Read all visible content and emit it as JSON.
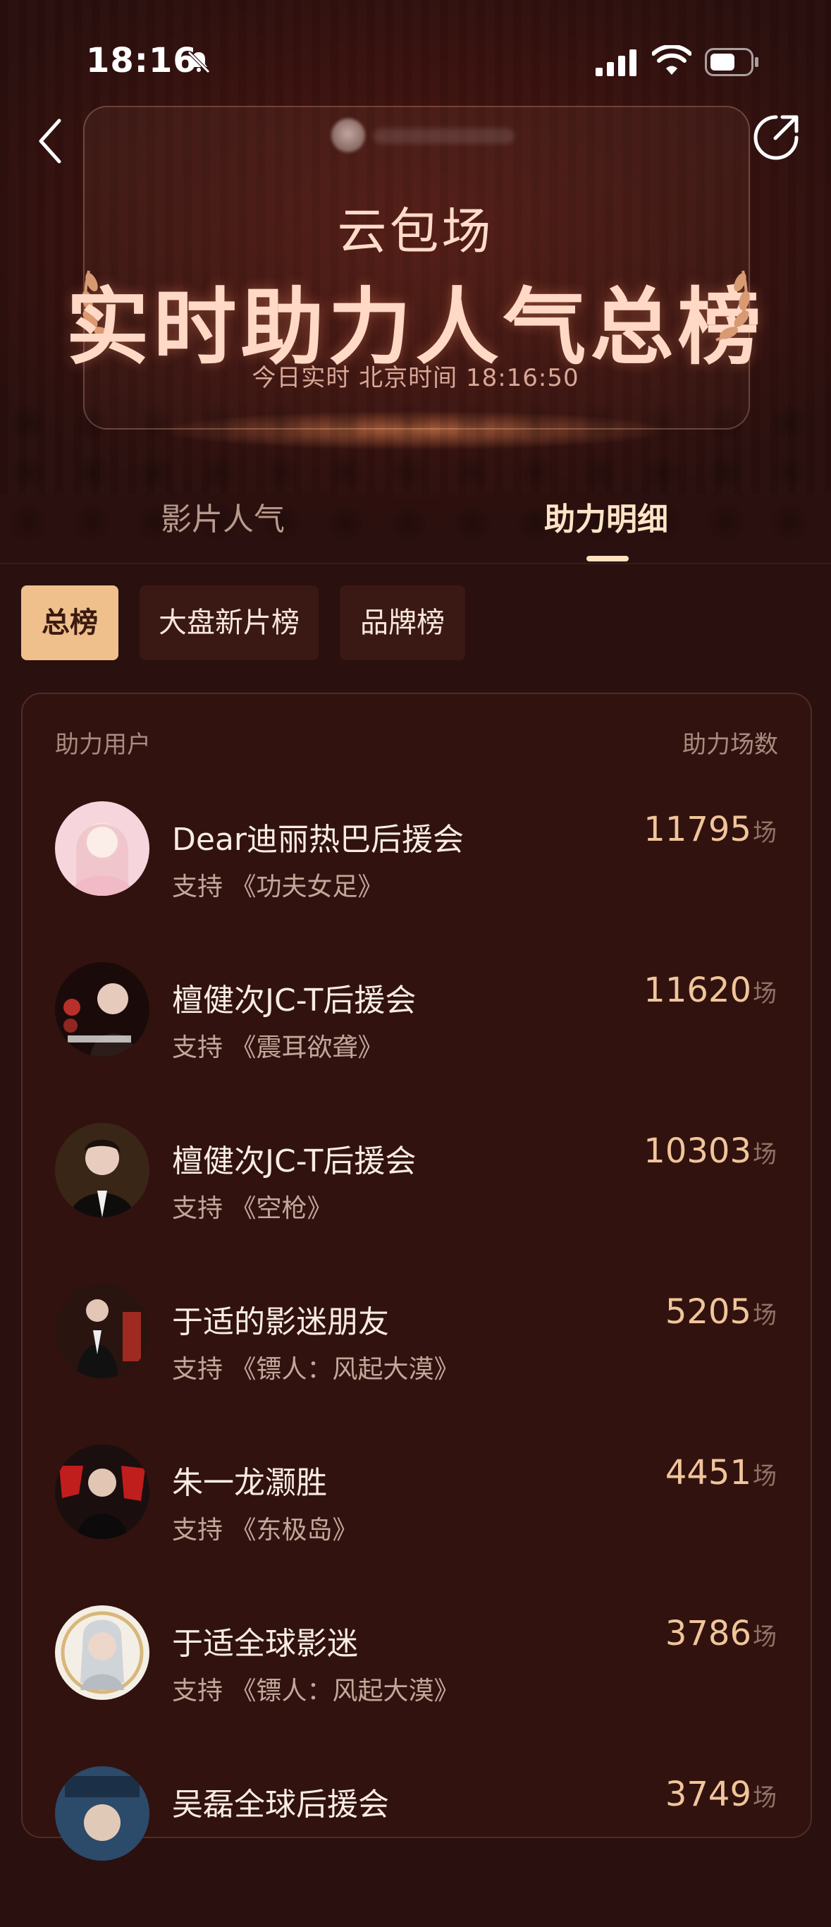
{
  "status": {
    "time": "18:16"
  },
  "header": {
    "subtitle": "云包场",
    "title": "实时助力人气总榜",
    "timestamp": "今日实时 北京时间 18:16:50"
  },
  "tabs": [
    {
      "label": "影片人气",
      "active": false
    },
    {
      "label": "助力明细",
      "active": true
    }
  ],
  "chips": [
    {
      "label": "总榜",
      "active": true
    },
    {
      "label": "大盘新片榜",
      "active": false
    },
    {
      "label": "品牌榜",
      "active": false
    }
  ],
  "list": {
    "header_left": "助力用户",
    "header_right": "助力场数",
    "unit": "场",
    "rows": [
      {
        "name": "Dear迪丽热巴后援会",
        "support": "支持 《功夫女足》",
        "count": "11795",
        "avatar_icon": "avatar-pink"
      },
      {
        "name": "檀健次JC-T后援会",
        "support": "支持 《震耳欲聋》",
        "count": "11620",
        "avatar_icon": "avatar-dark-red"
      },
      {
        "name": "檀健次JC-T后援会",
        "support": "支持 《空枪》",
        "count": "10303",
        "avatar_icon": "avatar-dark"
      },
      {
        "name": "于适的影迷朋友",
        "support": "支持 《镖人：风起大漠》",
        "count": "5205",
        "avatar_icon": "avatar-dark-red"
      },
      {
        "name": "朱一龙灏胜",
        "support": "支持 《东极岛》",
        "count": "4451",
        "avatar_icon": "avatar-red"
      },
      {
        "name": "于适全球影迷",
        "support": "支持 《镖人：风起大漠》",
        "count": "3786",
        "avatar_icon": "avatar-light"
      },
      {
        "name": "吴磊全球后援会",
        "support": "",
        "count": "3749",
        "avatar_icon": "avatar-blue"
      }
    ]
  },
  "colors": {
    "background": "#2a100e",
    "accent_chip": "#efc08c",
    "count": "#f0c59a",
    "title": "#ffd9c6"
  }
}
